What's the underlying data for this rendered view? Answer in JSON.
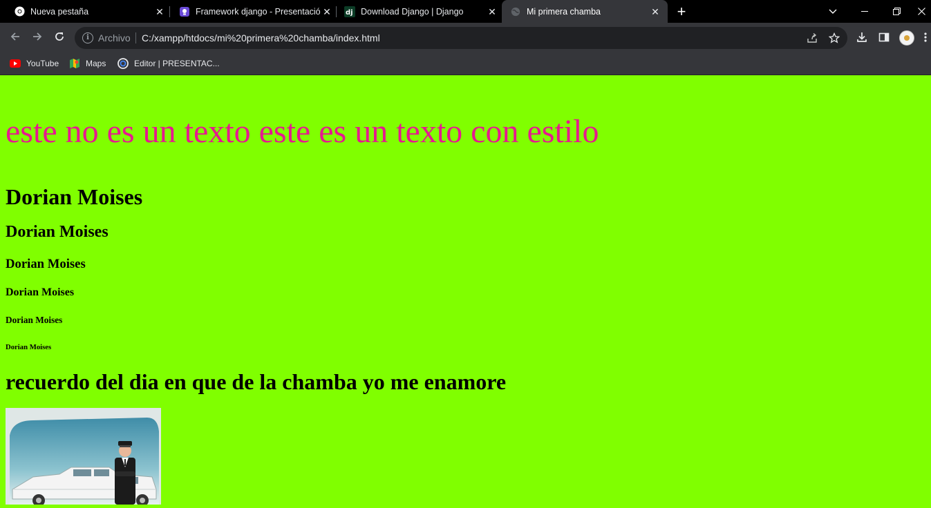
{
  "browser": {
    "tabs": [
      {
        "title": "Nueva pestaña",
        "icon": "chrome-icon",
        "active": false
      },
      {
        "title": "Framework django - Presentació",
        "icon": "presentation-icon",
        "active": false
      },
      {
        "title": "Download Django | Django",
        "icon": "django-icon",
        "active": false
      },
      {
        "title": "Mi primera chamba",
        "icon": "globe-icon",
        "active": true
      }
    ],
    "address": {
      "scheme_label": "Archivo",
      "url": "C:/xampp/htdocs/mi%20primera%20chamba/index.html"
    },
    "bookmarks": [
      {
        "label": "YouTube",
        "icon": "youtube-icon"
      },
      {
        "label": "Maps",
        "icon": "maps-icon"
      },
      {
        "label": "Editor | PRESENTAC...",
        "icon": "canva-icon"
      }
    ]
  },
  "page": {
    "background_color": "#80ff00",
    "styled_text": "este no es un texto este es un texto con estilo",
    "styled_text_color": "#e6198f",
    "headings": [
      "Dorian Moises",
      "Dorian Moises",
      "Dorian Moises",
      "Dorian Moises",
      "Dorian Moises",
      "Dorian Moises"
    ],
    "memory_heading": "recuerdo del dia en que de la chamba yo me enamore",
    "image": {
      "description_icon": "chauffeur-limousine-image"
    }
  }
}
